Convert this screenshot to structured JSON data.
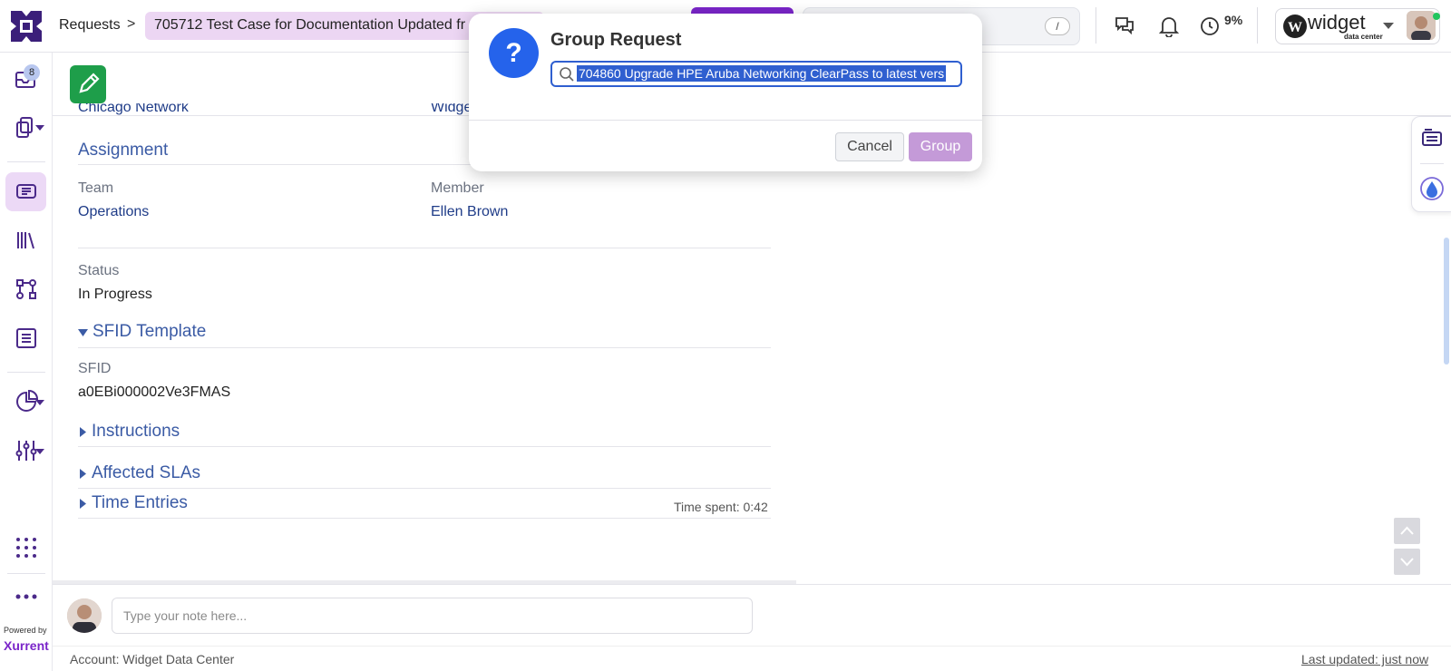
{
  "header": {
    "breadcrumb_root": "Requests",
    "breadcrumb_sep": ">",
    "request_title": "705712  Test Case for Documentation Updated fr",
    "search_shortcut": "/",
    "time_percent": "9%",
    "account_brand": "widget",
    "account_sub": "data center"
  },
  "rail": {
    "inbox_count": "8",
    "powered_by": "Powered by",
    "brand": "Xurrent"
  },
  "content": {
    "top_partial_left": "Chicago Network",
    "top_partial_right": "Widget",
    "assignment_heading": "Assignment",
    "team_label": "Team",
    "team_value": "Operations",
    "member_label": "Member",
    "member_value": "Ellen Brown",
    "status_label": "Status",
    "status_value": "In Progress",
    "sfid_template_heading": "SFID Template",
    "sfid_label": "SFID",
    "sfid_value": "a0EBi000002Ve3FMAS",
    "instructions_heading": "Instructions",
    "affected_slas_heading": "Affected SLAs",
    "time_entries_heading": "Time Entries",
    "time_spent": "Time spent: 0:42"
  },
  "note": {
    "placeholder": "Type your note here..."
  },
  "footer": {
    "account": "Account: Widget Data Center",
    "last_updated": "Last updated: just now"
  },
  "modal": {
    "icon": "?",
    "title": "Group Request",
    "search_value": "704860  Upgrade HPE Aruba Networking ClearPass to latest vers",
    "cancel_label": "Cancel",
    "group_label": "Group"
  },
  "colors": {
    "brand_purple": "#7a25c9",
    "link_blue": "#1f3c88",
    "section_blue": "#3b5ba5",
    "primary_blue": "#2563eb",
    "edit_green": "#1e9e4a",
    "group_disabled": "#c49ad8"
  }
}
